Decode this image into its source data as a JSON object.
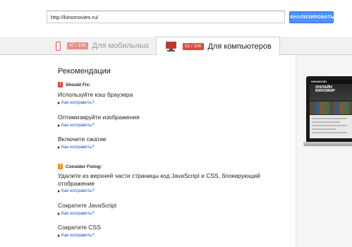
{
  "search": {
    "url_value": "http://kinomoviex.ru/",
    "analyze_label": "АНАЛИЗИРОВАТЬ"
  },
  "tabs": {
    "mobile": {
      "score": "47 / 100",
      "label": "Для мобильных"
    },
    "desktop": {
      "score": "52 / 100",
      "label": "Для компьютеров"
    }
  },
  "main": {
    "heading": "Рекомендации",
    "should_fix": {
      "title": "Should Fix:",
      "items": [
        {
          "title": "Используйте кэш браузера",
          "link": "Как исправить?"
        },
        {
          "title": "Оптимизируйте изображения",
          "link": "Как исправить?"
        },
        {
          "title": "Включите сжатие",
          "link": "Как исправить?"
        }
      ]
    },
    "consider_fixing": {
      "title": "Consider Fixing:",
      "items": [
        {
          "title": "Удалите из верхней части страницы код JavaScript и CSS, блокирующий отображение",
          "link": "Как исправить?"
        },
        {
          "title": "Сократите JavaScript",
          "link": "Как исправить?"
        },
        {
          "title": "Сократите CSS",
          "link": "Как исправить?"
        }
      ]
    }
  },
  "preview": {
    "logo_text": "KINOMOVIEX",
    "banner_text": "ОНЛАЙН КИНОМИР"
  },
  "colors": {
    "accent": "#4d90fe",
    "warning_red": "#dd4b39",
    "warning_orange": "#f09300",
    "link": "#1155cc"
  }
}
